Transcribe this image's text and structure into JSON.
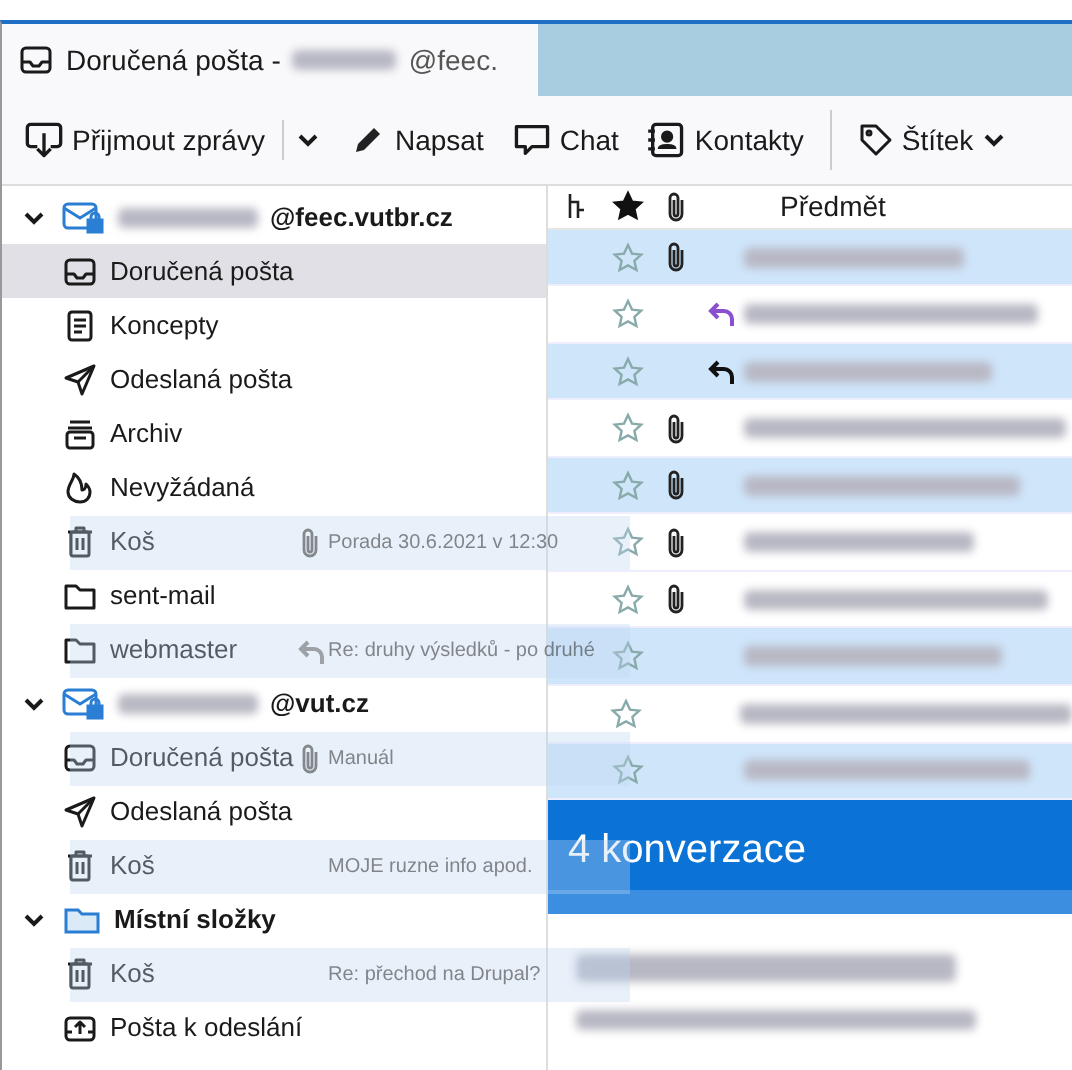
{
  "tab": {
    "title": "Doručená pošta -",
    "account_tail": "@feec.",
    "selected": true
  },
  "toolbar": [
    {
      "kind": "get",
      "label": "Přijmout zprávy",
      "split_menu": true
    },
    {
      "kind": "write",
      "label": "Napsat"
    },
    {
      "kind": "chat",
      "label": "Chat"
    },
    {
      "kind": "contacts",
      "label": "Kontakty"
    },
    {
      "kind": "tag",
      "label": "Štítek",
      "dropdown": true
    }
  ],
  "folders": [
    {
      "kind": "account",
      "label": "@feec.vutbr.cz",
      "expanded": true,
      "selected": false,
      "children": [
        {
          "kind": "inbox",
          "label": "Doručená pošta",
          "selected": true
        },
        {
          "kind": "drafts",
          "label": "Koncepty",
          "selected": false
        },
        {
          "kind": "sent",
          "label": "Odeslaná pošta",
          "selected": false
        },
        {
          "kind": "archive",
          "label": "Archiv",
          "selected": false
        },
        {
          "kind": "junk",
          "label": "Nevyžádaná",
          "selected": false
        },
        {
          "kind": "trash",
          "label": "Koš",
          "selected": false
        },
        {
          "kind": "folder",
          "label": "sent-mail",
          "selected": false
        },
        {
          "kind": "folder",
          "label": "webmaster",
          "selected": false
        }
      ]
    },
    {
      "kind": "account",
      "label": "@vut.cz",
      "expanded": true,
      "selected": false,
      "children": [
        {
          "kind": "inbox",
          "label": "Doručená pošta",
          "selected": false
        },
        {
          "kind": "sent",
          "label": "Odeslaná pošta",
          "selected": false
        },
        {
          "kind": "trash",
          "label": "Koš",
          "selected": false
        }
      ]
    },
    {
      "kind": "local",
      "label": "Místní složky",
      "expanded": true,
      "selected": false,
      "children": [
        {
          "kind": "trash",
          "label": "Koš",
          "selected": false
        },
        {
          "kind": "outbox",
          "label": "Pošta k odeslání",
          "selected": false
        }
      ]
    }
  ],
  "columns": [
    {
      "kind": "thread"
    },
    {
      "kind": "star"
    },
    {
      "kind": "attachment"
    },
    {
      "kind": "text",
      "label": "Předmět"
    }
  ],
  "messages": [
    {
      "selected": true,
      "attachment": true,
      "replied": false
    },
    {
      "selected": false,
      "attachment": false,
      "replied": true
    },
    {
      "selected": true,
      "attachment": false,
      "replied": true
    },
    {
      "selected": false,
      "attachment": true,
      "replied": false
    },
    {
      "selected": true,
      "attachment": true,
      "replied": false
    },
    {
      "selected": false,
      "attachment": true,
      "replied": false
    },
    {
      "selected": false,
      "attachment": true,
      "replied": false
    },
    {
      "selected": true,
      "attachment": false,
      "replied": false
    },
    {
      "selected": false,
      "attachment": false,
      "replied": false
    },
    {
      "selected": true,
      "attachment": false,
      "replied": false
    }
  ],
  "summary": {
    "label": "4 konverzace"
  },
  "drag_ghost": [
    {
      "subject": "Porada 30.6.2021 v 12:30",
      "attachment": true,
      "replied": false
    },
    {
      "subject": "Re: druhy výsledků - po druhé",
      "attachment": false,
      "replied": true
    },
    {
      "subject": "Manuál",
      "attachment": true,
      "replied": false
    },
    {
      "subject": "MOJE ruzne info apod.",
      "attachment": false,
      "replied": false
    },
    {
      "subject": "Re: přechod na Drupal?",
      "attachment": false,
      "replied": false
    }
  ]
}
